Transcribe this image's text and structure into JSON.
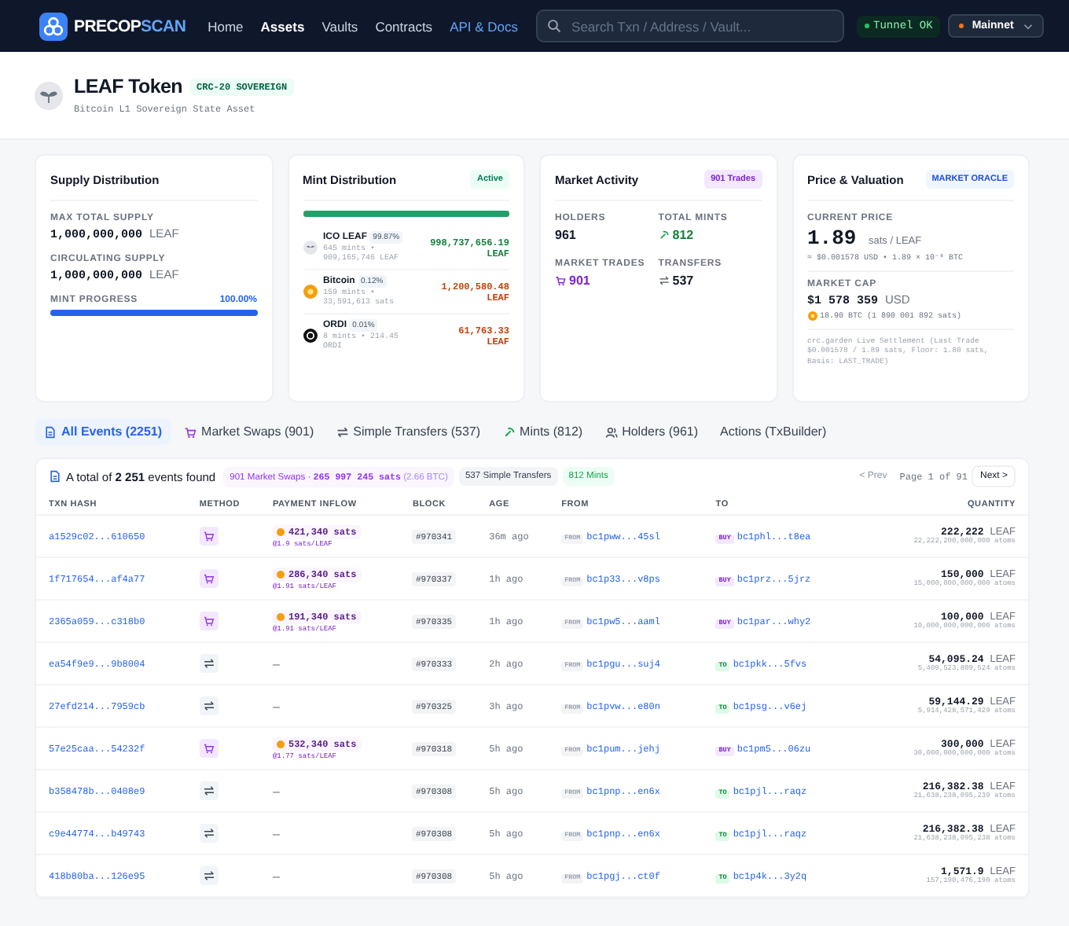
{
  "header": {
    "logo": {
      "first": "PRECOP",
      "second": "SCAN"
    },
    "nav": [
      {
        "label": "Home",
        "selected": false,
        "kind": "plain"
      },
      {
        "label": "Assets",
        "selected": true,
        "kind": "plain"
      },
      {
        "label": "Vaults",
        "selected": false,
        "kind": "plain"
      },
      {
        "label": "Contracts",
        "selected": false,
        "kind": "plain"
      },
      {
        "label": "API & Docs",
        "selected": false,
        "kind": "highlight"
      }
    ],
    "search": {
      "placeholder": "Search Txn / Address / Vault..."
    },
    "tunnel": "Tunnel OK",
    "network": "Mainnet"
  },
  "token": {
    "name": "LEAF Token",
    "badge": "CRC-20 SOVEREIGN",
    "subtitle": "Bitcoin L1 Sovereign State Asset"
  },
  "supply": {
    "title": "Supply Distribution",
    "rows": [
      {
        "label": "MAX TOTAL SUPPLY",
        "value": "1,000,000,000",
        "unit": "LEAF"
      },
      {
        "label": "CIRCULATING SUPPLY",
        "value": "1,000,000,000",
        "unit": "LEAF"
      }
    ],
    "progress": {
      "label": "MINT PROGRESS",
      "reading": "100.00%",
      "level": 1
    }
  },
  "mint": {
    "title": "Mint Distribution",
    "badge": "Active",
    "level": 0.9987,
    "items": [
      {
        "kind": "leaf",
        "name": "ICO LEAF",
        "share": "99.87%",
        "detail": "645 mints • 909,165,746 LEAF",
        "amount": "998,737,656.19",
        "unit": "LEAF"
      },
      {
        "kind": "bitcoin",
        "name": "Bitcoin",
        "share": "0.12%",
        "detail": "159 mints • 33,591,613 sats",
        "amount": "1,200,580.48",
        "unit": "LEAF"
      },
      {
        "kind": "ordi",
        "name": "ORDI",
        "share": "0.01%",
        "detail": "8 mints • 214.45 ORDI",
        "amount": "61,763.33",
        "unit": "LEAF"
      }
    ]
  },
  "market": {
    "title": "Market Activity",
    "badge": "901 Trades",
    "stats": [
      {
        "kind": "plain",
        "label": "HOLDERS",
        "value": "961"
      },
      {
        "kind": "mint",
        "label": "TOTAL MINTS",
        "value": "812"
      },
      {
        "kind": "trade",
        "label": "MARKET TRADES",
        "value": "901"
      },
      {
        "kind": "transfer",
        "label": "TRANSFERS",
        "value": "537"
      }
    ]
  },
  "price": {
    "title": "Price & Valuation",
    "badge": "MARKET ORACLE",
    "current": {
      "label": "CURRENT PRICE",
      "value": "1.89",
      "unit": "sats / LEAF",
      "conversion": "≈ $0.001578 USD • 1.89 × 10⁻⁸ BTC"
    },
    "cap": {
      "label": "MARKET CAP",
      "value": "$1 578 359",
      "unit": "USD",
      "btc": "18.90 BTC (1 890 001 892 sats)"
    },
    "note": "crc.garden Live Settlement (Last Trade $0.001578 / 1.89 sats, Floor: 1.80 sats, Basis: LAST_TRADE)"
  },
  "tabs": [
    {
      "kind": "doc",
      "label": "All Events (2251)",
      "selected": true
    },
    {
      "kind": "trade",
      "label": "Market Swaps (901)",
      "selected": false
    },
    {
      "kind": "transfer",
      "label": "Simple Transfers (537)",
      "selected": false
    },
    {
      "kind": "mint",
      "label": "Mints (812)",
      "selected": false
    },
    {
      "kind": "holders",
      "label": "Holders (961)",
      "selected": false
    },
    {
      "kind": "plain",
      "label": "Actions (TxBuilder)",
      "selected": false
    }
  ],
  "summary": {
    "total": "A total of **2 251** events found",
    "swaps": {
      "label": "901 Market Swaps",
      "sep": "·",
      "sats": "265 997 245 sats",
      "btc": "(2.66 BTC)"
    },
    "transfers": "537 Simple Transfers",
    "mints": "812 Mints",
    "pagination": {
      "prev": "< Prev",
      "prev_disabled": true,
      "page": "Page 1 of 91",
      "next": "Next >"
    }
  },
  "table": {
    "columns": [
      "TXN HASH",
      "METHOD",
      "PAYMENT INFLOW",
      "BLOCK",
      "AGE",
      "FROM",
      "TO",
      "QUANTITY"
    ],
    "rows": [
      {
        "kind": "swap",
        "hash": "a1529c02...610650",
        "payment": {
          "amount": "421,340 sats",
          "rate": "@1.9 sats/LEAF"
        },
        "block": "#970341",
        "age": "36m ago",
        "from_tag": "FROM",
        "from": "bc1pww...45sl",
        "to": {
          "kind": "buy",
          "tag": "BUY",
          "address": "bc1phl...t8ea"
        },
        "quantity": "222,222",
        "unit": "LEAF",
        "atoms": "22,222,200,000,000 atoms"
      },
      {
        "kind": "swap",
        "hash": "1f717654...af4a77",
        "payment": {
          "amount": "286,340 sats",
          "rate": "@1.91 sats/LEAF"
        },
        "block": "#970337",
        "age": "1h ago",
        "from_tag": "FROM",
        "from": "bc1p33...v8ps",
        "to": {
          "kind": "buy",
          "tag": "BUY",
          "address": "bc1prz...5jrz"
        },
        "quantity": "150,000",
        "unit": "LEAF",
        "atoms": "15,000,000,000,000 atoms"
      },
      {
        "kind": "swap",
        "hash": "2365a059...c318b0",
        "payment": {
          "amount": "191,340 sats",
          "rate": "@1.91 sats/LEAF"
        },
        "block": "#970335",
        "age": "1h ago",
        "from_tag": "FROM",
        "from": "bc1pw5...aaml",
        "to": {
          "kind": "buy",
          "tag": "BUY",
          "address": "bc1par...why2"
        },
        "quantity": "100,000",
        "unit": "LEAF",
        "atoms": "10,000,000,000,000 atoms"
      },
      {
        "kind": "transfer",
        "hash": "ea54f9e9...9b8004",
        "payment_empty": "–",
        "block": "#970333",
        "age": "2h ago",
        "from_tag": "FROM",
        "from": "bc1pgu...suj4",
        "to": {
          "kind": "to",
          "tag": "TO",
          "address": "bc1pkk...5fvs"
        },
        "quantity": "54,095.24",
        "unit": "LEAF",
        "atoms": "5,409,523,809,524 atoms"
      },
      {
        "kind": "transfer",
        "hash": "27efd214...7959cb",
        "payment_empty": "–",
        "block": "#970325",
        "age": "3h ago",
        "from_tag": "FROM",
        "from": "bc1pvw...e80n",
        "to": {
          "kind": "to",
          "tag": "TO",
          "address": "bc1psg...v6ej"
        },
        "quantity": "59,144.29",
        "unit": "LEAF",
        "atoms": "5,914,428,571,429 atoms"
      },
      {
        "kind": "swap",
        "hash": "57e25caa...54232f",
        "payment": {
          "amount": "532,340 sats",
          "rate": "@1.77 sats/LEAF"
        },
        "block": "#970318",
        "age": "5h ago",
        "from_tag": "FROM",
        "from": "bc1pum...jehj",
        "to": {
          "kind": "buy",
          "tag": "BUY",
          "address": "bc1pm5...06zu"
        },
        "quantity": "300,000",
        "unit": "LEAF",
        "atoms": "30,000,000,000,000 atoms"
      },
      {
        "kind": "transfer",
        "hash": "b358478b...0408e9",
        "payment_empty": "–",
        "block": "#970308",
        "age": "5h ago",
        "from_tag": "FROM",
        "from": "bc1pnp...en6x",
        "to": {
          "kind": "to",
          "tag": "TO",
          "address": "bc1pjl...raqz"
        },
        "quantity": "216,382.38",
        "unit": "LEAF",
        "atoms": "21,638,238,095,239 atoms"
      },
      {
        "kind": "transfer",
        "hash": "c9e44774...b49743",
        "payment_empty": "–",
        "block": "#970308",
        "age": "5h ago",
        "from_tag": "FROM",
        "from": "bc1pnp...en6x",
        "to": {
          "kind": "to",
          "tag": "TO",
          "address": "bc1pjl...raqz"
        },
        "quantity": "216,382.38",
        "unit": "LEAF",
        "atoms": "21,638,238,095,238 atoms"
      },
      {
        "kind": "transfer",
        "hash": "418b80ba...126e95",
        "payment_empty": "–",
        "block": "#970308",
        "age": "5h ago",
        "from_tag": "FROM",
        "from": "bc1pgj...ct0f",
        "to": {
          "kind": "to",
          "tag": "TO",
          "address": "bc1p4k...3y2q"
        },
        "quantity": "1,571.9",
        "unit": "LEAF",
        "atoms": "157,190,476,190 atoms"
      }
    ]
  }
}
